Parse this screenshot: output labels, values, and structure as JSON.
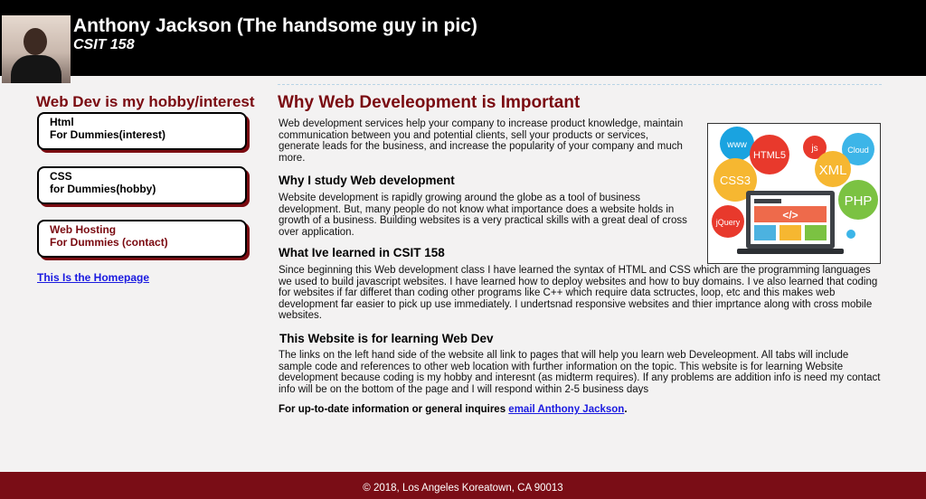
{
  "header": {
    "title": "Anthony Jackson (The handsome guy in pic)",
    "subtitle": "CSIT 158"
  },
  "sidebar": {
    "heading": "Web Dev is my hobby/interest",
    "cards": [
      {
        "line1": "Html",
        "line2": "For Dummies(interest)"
      },
      {
        "line1": "CSS",
        "line2": "for Dummies(hobby)"
      },
      {
        "line1": "Web Hosting",
        "line2": "For Dummies (contact)"
      }
    ],
    "home_link": "This Is the Homepage"
  },
  "main": {
    "heading": "Why Web Develeopment is Important",
    "intro": "Web development services help your company to increase product knowledge, maintain communication between you and potential clients, sell your products or services, generate leads for the business, and increase the popularity of your company and much more.",
    "why_heading": "Why I study Web development",
    "why_text": "Website development is rapidly growing around the globe as a tool of business development. But, many people do not know what importance does a website holds in growth of a business. Building websites is a very practical skills with a great deal of cross over application.",
    "learned_heading": "What Ive learned in CSIT 158",
    "learned_text": "Since beginning this Web development class I have learned the syntax of HTML and CSS which are the programming languages we used to build javascript websites. I have learned how to deploy websites and how to buy domains. I ve also learned that coding for websites if far differet than coding other programs like C++ which require data sctructes, loop, etc and this makes web development far easier to pick up use immediately. I undertsnad responsive websites and thier imprtance along with cross mobile websites.",
    "this_heading": "This Website is for learning Web Dev",
    "this_text": "The links on the left hand side of the website all link to pages that will help you learn web Develeopment. All tabs will include sample code and references to other web location with further information on the topic. This website is for learning Website development because coding is my hobby and interesnt (as midterm requires). If any problems are addition info is need my contact info will be on the bottom of the page and I will respond within 2-5 business days",
    "inquire_prefix": "For up-to-date information or general inquires ",
    "email_link": "email Anthony Jackson",
    "inquire_suffix": "."
  },
  "image_labels": {
    "www": "www",
    "html5": "HTML5",
    "js": "js",
    "cloud": "Cloud",
    "css3": "CSS3",
    "xml": "XML",
    "php": "PHP",
    "jquery": "jQuery",
    "code": "</>"
  },
  "footer": {
    "text": "© 2018, Los Angeles Koreatown, CA 90013"
  },
  "colors": {
    "accent": "#7a0a10",
    "footer_bg": "#7a0d16",
    "link": "#1a1ae0"
  }
}
